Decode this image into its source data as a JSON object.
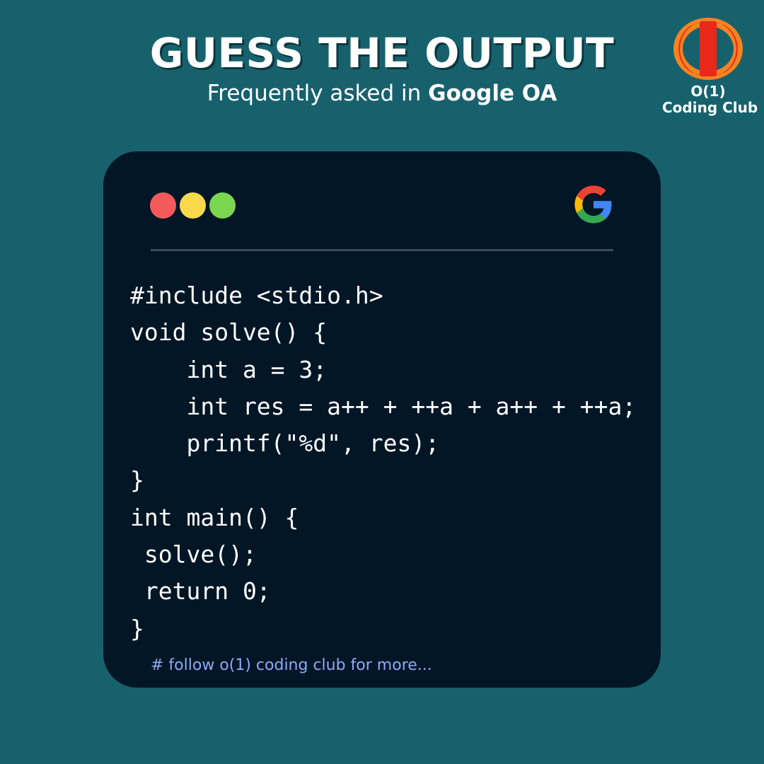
{
  "header": {
    "title": "GUESS THE OUTPUT",
    "subtitle_prefix": "Frequently asked in ",
    "subtitle_company": "Google OA"
  },
  "brand": {
    "logo_icon": "o1-coding-club-logo-icon",
    "line1": "O(1)",
    "line2": "Coding Club"
  },
  "card": {
    "window_dots": [
      "close-dot",
      "minimize-dot",
      "maximize-dot"
    ],
    "corner_icon": "google-g-icon",
    "code_lines": [
      "#include <stdio.h>",
      "void solve() {",
      "    int a = 3;",
      "    int res = a++ + ++a + a++ + ++a;",
      "    printf(\"%d\", res);",
      "}",
      "int main() {",
      " solve();",
      " return 0;",
      "}"
    ],
    "footer": "# follow o(1) coding club for more..."
  },
  "colors": {
    "background": "#17616d",
    "card": "#021626",
    "dot_red": "#f55a5a",
    "dot_yellow": "#f9d94c",
    "dot_green": "#7bd64f",
    "footer_text": "#8fa8f5",
    "logo_red": "#e8291c",
    "logo_orange": "#f4841f"
  }
}
